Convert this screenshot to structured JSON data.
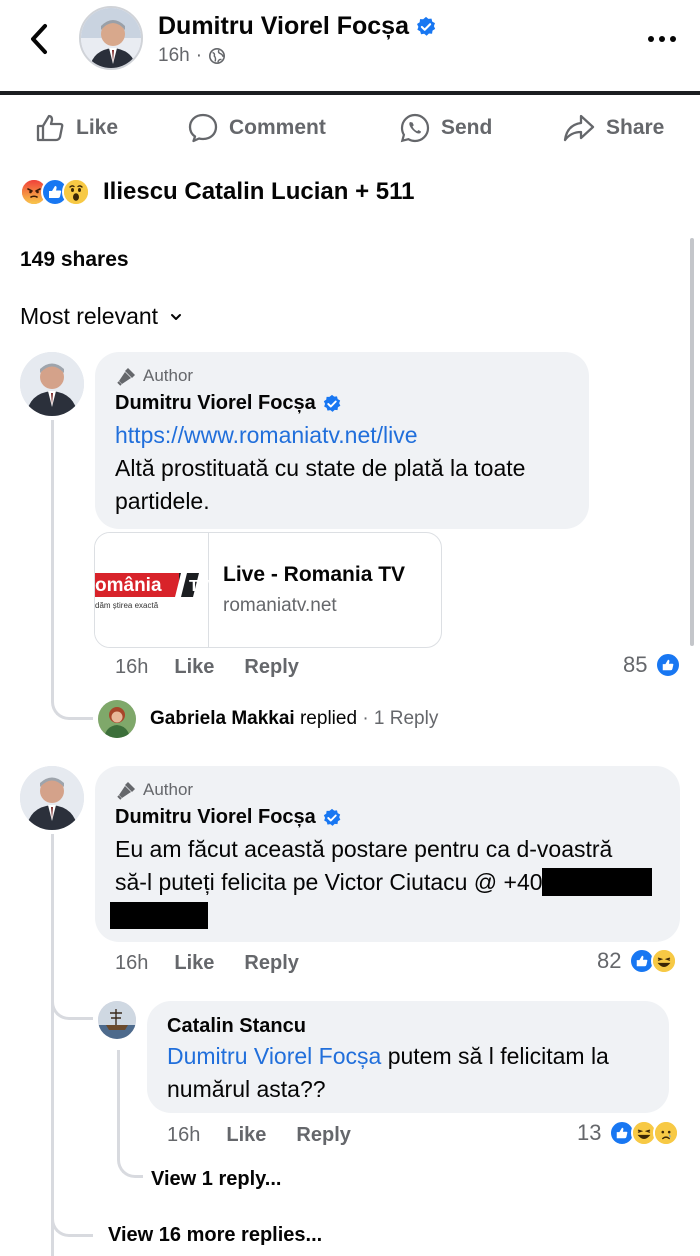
{
  "header": {
    "poster_name": "Dumitru Viorel Focșa",
    "post_time": "16h",
    "separator": "·"
  },
  "actions": {
    "like": "Like",
    "comment": "Comment",
    "send": "Send",
    "share": "Share"
  },
  "reactions": {
    "icons": [
      "angry-icon",
      "like-icon",
      "wow-icon"
    ],
    "text": "Iliescu Catalin Lucian + 511"
  },
  "shares": "149 shares",
  "sort_label": "Most relevant",
  "comments": [
    {
      "badge": "Author",
      "name": "Dumitru Viorel Focșa",
      "link": "https://www.romaniatv.net/live",
      "text": "Altă prostituată cu state de plată la toate partidele.",
      "card": {
        "title": "Live - Romania TV",
        "domain": "romaniatv.net",
        "logo_text": "omânia",
        "logo_tag": "TV",
        "logo_slogan": "dăm știrea exactă"
      },
      "time": "16h",
      "like": "Like",
      "reply": "Reply",
      "reaction_count": "85",
      "replied": {
        "name": "Gabriela Makkai",
        "verb": "replied",
        "count": "· 1 Reply"
      }
    },
    {
      "badge": "Author",
      "name": "Dumitru Viorel Focșa",
      "text_line1": "Eu am făcut această postare pentru ca d-voastră",
      "text_line2": "să-l puteți felicita pe Victor Ciutacu @ +40 7",
      "time": "16h",
      "like": "Like",
      "reply": "Reply",
      "reaction_count": "82",
      "reply_comment": {
        "name": "Catalin Stancu",
        "mention": "Dumitru Viorel Focșa",
        "text_line1": " putem să l felicitam la",
        "text_line2": "numărul asta??",
        "time": "16h",
        "like": "Like",
        "reply": "Reply",
        "reaction_count": "13",
        "view_replies": "View 1 reply..."
      },
      "view_more": "View 16 more replies..."
    }
  ],
  "colors": {
    "verified": "#1877f2",
    "link": "#216fdb",
    "bubble": "#f0f2f5",
    "muted": "#65676b"
  }
}
